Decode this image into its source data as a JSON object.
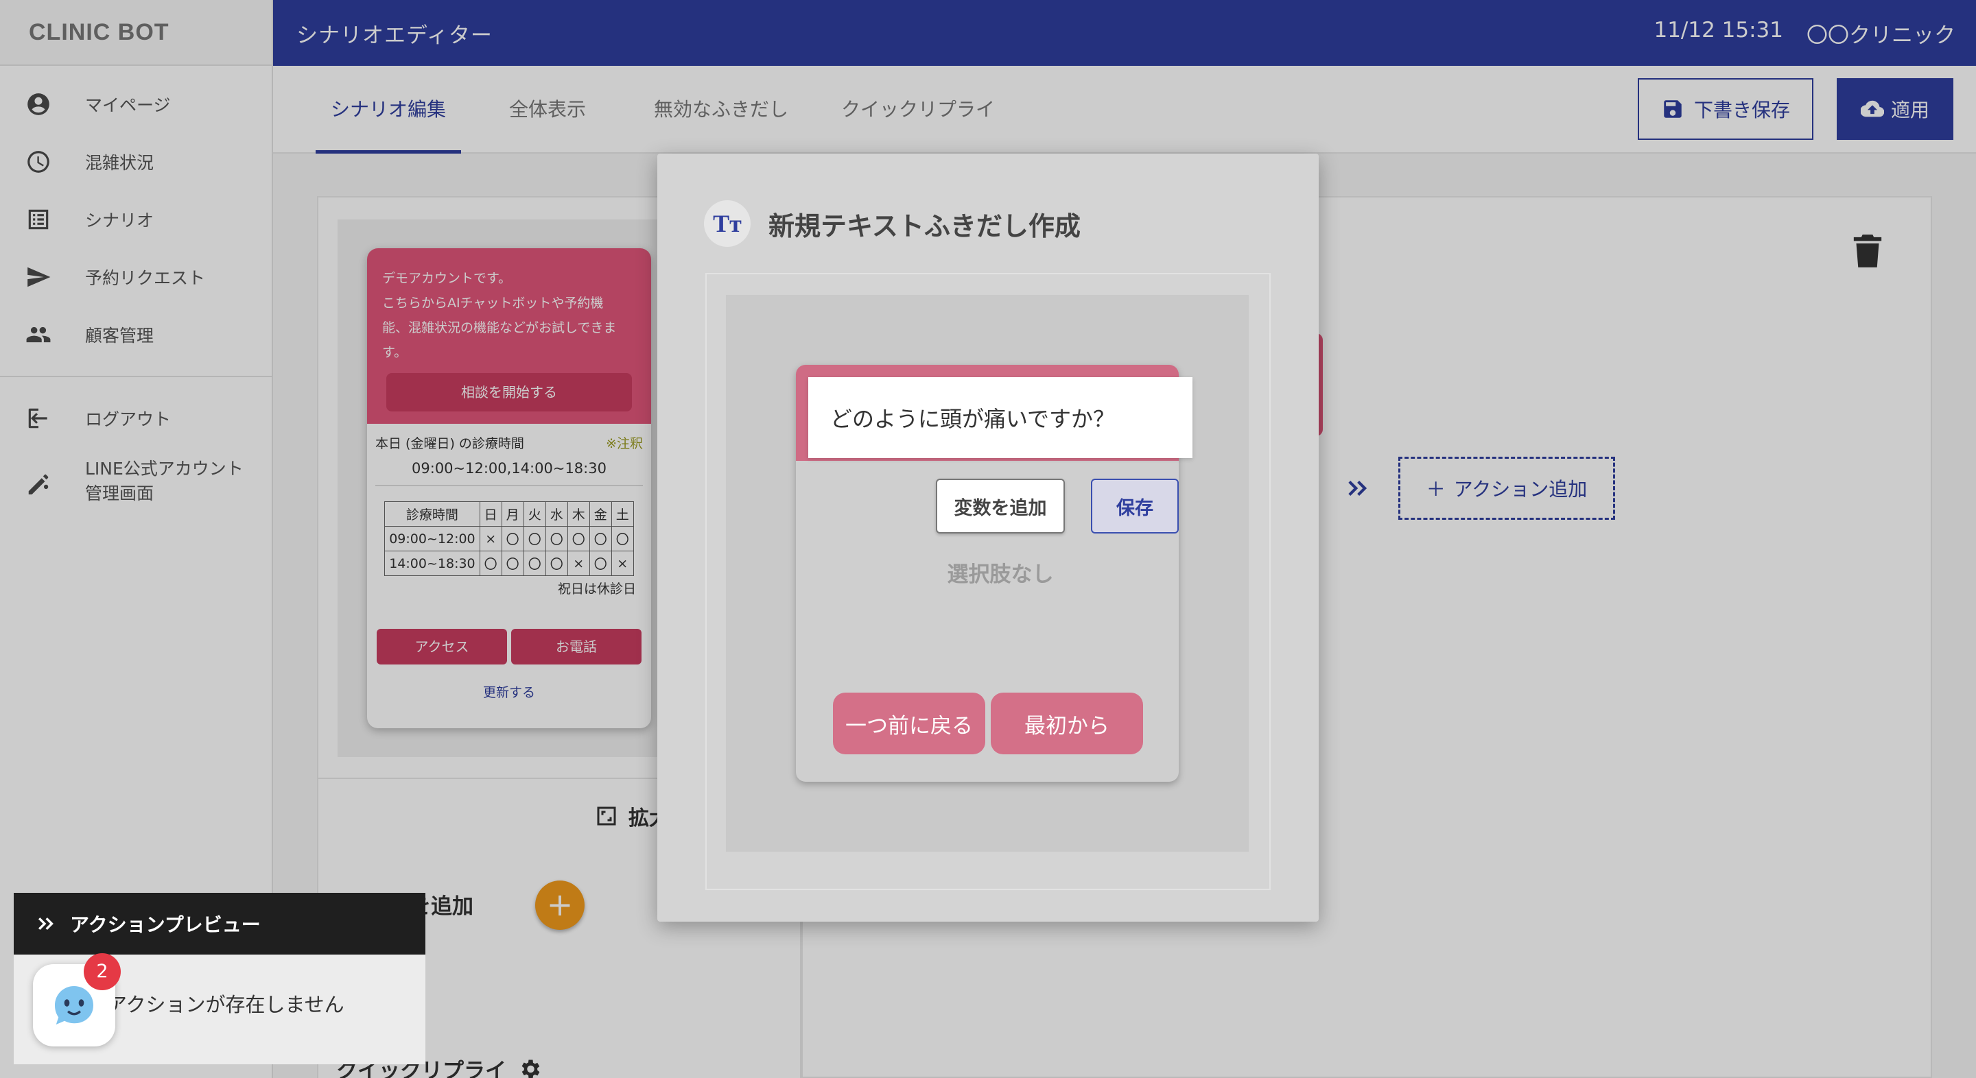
{
  "app": {
    "brand": "CLINIC BOT",
    "page_title": "シナリオエディター",
    "datetime": "11/12 15:31",
    "clinic_name": "〇〇クリニック"
  },
  "sidebar": {
    "items": [
      {
        "label": "マイページ",
        "icon": "account-circle-icon"
      },
      {
        "label": "混雑状況",
        "icon": "clock-icon"
      },
      {
        "label": "シナリオ",
        "icon": "list-icon"
      },
      {
        "label": "予約リクエスト",
        "icon": "send-icon"
      },
      {
        "label": "顧客管理",
        "icon": "people-icon"
      }
    ],
    "logout": "ログアウト",
    "line_admin_line1": "LINE公式アカウント",
    "line_admin_line2": "管理画面"
  },
  "tabs": [
    {
      "label": "シナリオ編集",
      "active": true
    },
    {
      "label": "全体表示",
      "active": false
    },
    {
      "label": "無効なふきだし",
      "active": false
    },
    {
      "label": "クイックリプライ",
      "active": false
    }
  ],
  "toolbar": {
    "draft_label": "下書き保存",
    "apply_label": "適用"
  },
  "phone": {
    "intro_lines": [
      "デモアカウントです。",
      "こちらからAIチャットボットや予約機",
      "能、混雑状況の機能などがお試しできま",
      "す。"
    ],
    "cta": "相談を開始する",
    "today_label": "本日 (金曜日) の診療時間",
    "note": "※注釈",
    "today_hours": "09:00~12:00,14:00~18:30",
    "table_header": [
      "診療時間",
      "日",
      "月",
      "火",
      "水",
      "木",
      "金",
      "土"
    ],
    "table_rows": [
      [
        "09:00~12:00",
        "×",
        "〇",
        "〇",
        "〇",
        "〇",
        "〇",
        "〇"
      ],
      [
        "14:00~18:30",
        "〇",
        "〇",
        "〇",
        "〇",
        "×",
        "〇",
        "×"
      ]
    ],
    "holiday_note": "祝日は休診日",
    "btn_access": "アクセス",
    "btn_phone": "お電話",
    "refresh": "更新する"
  },
  "canvas": {
    "expand_label": "拡大",
    "add_card_label": "ドを追加",
    "add_card_btn": "+",
    "quick_reply_label": "クイックリプライ",
    "add_action": "アクション追加"
  },
  "preview": {
    "title": "アクションプレビュー",
    "empty": "アクションが存在しません",
    "badge_count": "2"
  },
  "modal": {
    "title": "新規テキストふきだし作成",
    "icon_text": "Tт",
    "input_value": "どのように頭が痛いですか？",
    "add_variable": "変数を追加",
    "save": "保存",
    "no_choices": "選択肢なし",
    "back": "一つ前に戻る",
    "from_start": "最初から"
  },
  "colors": {
    "primary": "#2f3e9e",
    "accent_pink": "#e0567a",
    "orange": "#f09a1c",
    "badge_red": "#e53945"
  }
}
